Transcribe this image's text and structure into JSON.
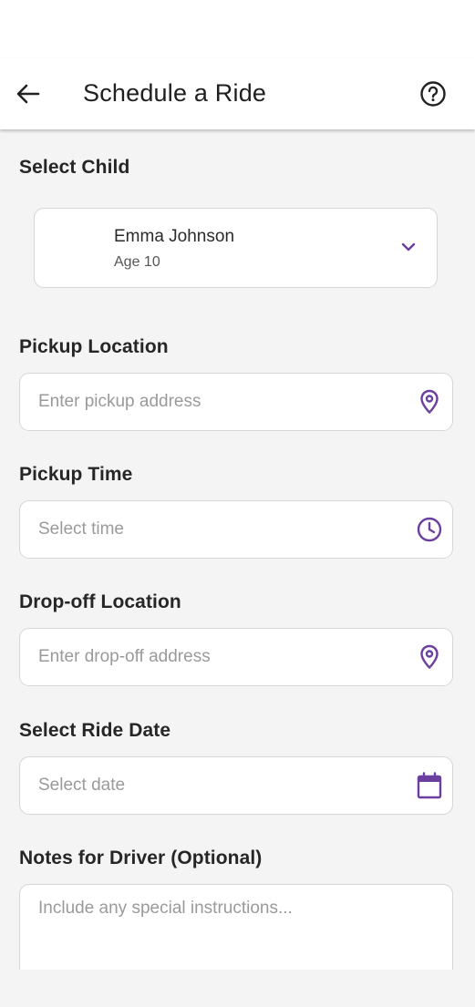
{
  "header": {
    "title": "Schedule a Ride",
    "back_icon": "arrow-left-icon",
    "help_icon": "help-circle-icon"
  },
  "child": {
    "label": "Select Child",
    "name": "Emma Johnson",
    "age": "Age 10",
    "dropdown_icon": "chevron-down-icon"
  },
  "pickup_location": {
    "label": "Pickup Location",
    "placeholder": "Enter pickup address",
    "icon": "map-pin-icon"
  },
  "pickup_time": {
    "label": "Pickup Time",
    "placeholder": "Select time",
    "icon": "clock-icon"
  },
  "dropoff_location": {
    "label": "Drop-off Location",
    "placeholder": "Enter drop-off address",
    "icon": "map-pin-icon"
  },
  "ride_date": {
    "label": "Select Ride Date",
    "placeholder": "Select date",
    "icon": "calendar-icon"
  },
  "notes": {
    "label": "Notes for Driver (Optional)",
    "placeholder": "Include any special instructions..."
  },
  "colors": {
    "accent": "#6b3fa0",
    "background": "#f4f4f4",
    "surface": "#ffffff",
    "border": "#d6d6d6"
  }
}
